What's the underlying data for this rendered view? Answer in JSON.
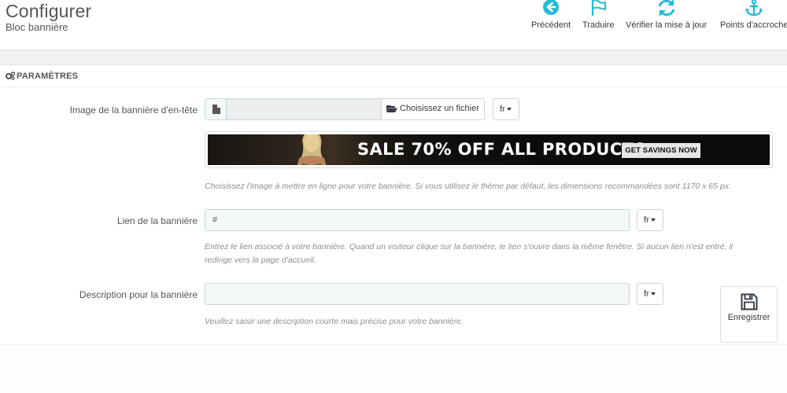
{
  "header": {
    "title": "Configurer",
    "subtitle": "Bloc bannière",
    "toolbar": [
      {
        "label": "Précédent",
        "icon": "circle-arrow-left-icon"
      },
      {
        "label": "Traduire",
        "icon": "flag-icon"
      },
      {
        "label": "Vérifier la mise à jour",
        "icon": "refresh-icon"
      },
      {
        "label": "Points d'accroche",
        "icon": "anchor-icon"
      }
    ]
  },
  "panel": {
    "heading": "PARAMÈTRES",
    "fields": {
      "banner_image": {
        "label": "Image de la bannière d'en-tête",
        "file_value": "",
        "choose_label": "Choisissez un fichier",
        "lang": "fr",
        "help": "Choisissez l'image à mettre en ligne pour votre bannière. Si vous utilisez le thème par défaut, les dimensions recommandées sont 1170 x 65 px."
      },
      "banner_preview": {
        "headline": "SALE 70% OFF ALL PRODUCTS",
        "cta": "GET SAVINGS NOW"
      },
      "banner_link": {
        "label": "Lien de la bannière",
        "value": "#",
        "lang": "fr",
        "help_line1": "Entrez le lien associé à votre bannière. Quand un visiteur clique sur la bannière, le lien s'ouvre dans la même fenêtre. Si aucun lien n'est entré, il",
        "help_line2": "redirige vers la page d'accueil."
      },
      "banner_description": {
        "label": "Description pour la bannière",
        "value": "",
        "lang": "fr",
        "help": "Veuillez saisir une description courte mais précise pour votre bannière."
      }
    },
    "save_label": "Enregistrer"
  },
  "colors": {
    "accent": "#25b9d7",
    "toolbar_text": "#363a41",
    "background": "#eff1f2"
  }
}
